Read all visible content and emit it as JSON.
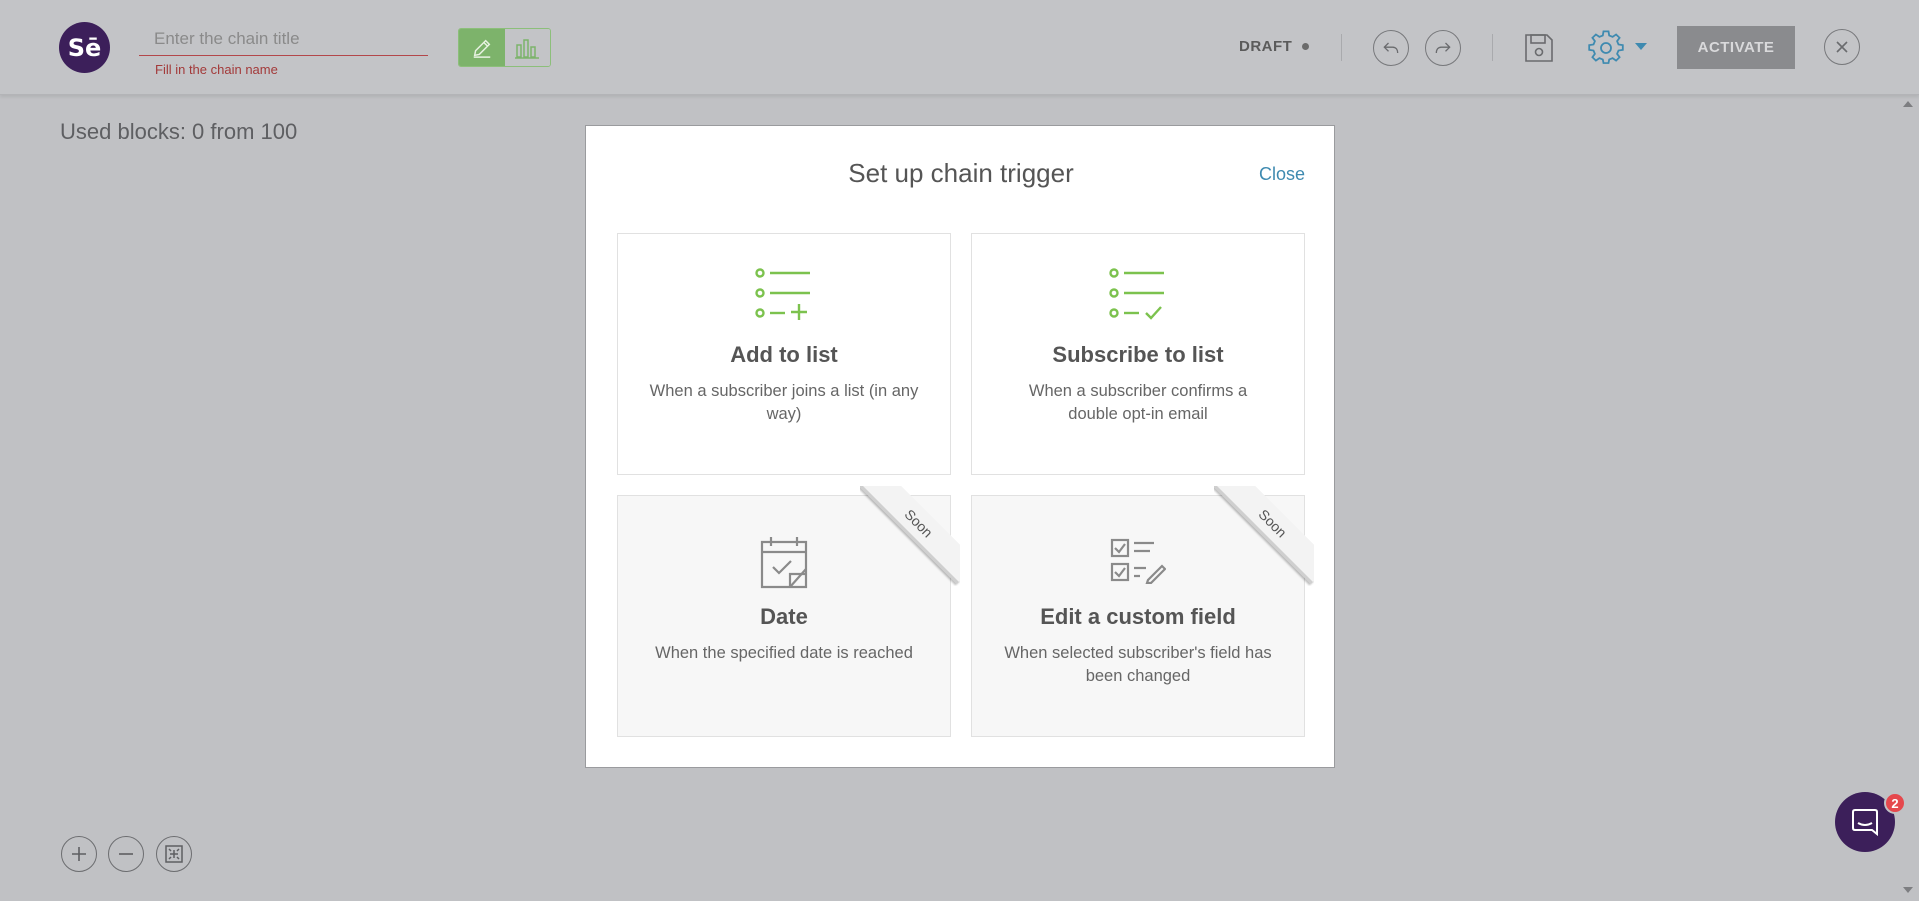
{
  "header": {
    "logo_text": "Sē",
    "title_placeholder": "Enter the chain title",
    "title_value": "",
    "title_error": "Fill in the chain name",
    "status": "DRAFT",
    "activate_label": "ACTIVATE",
    "icons": [
      "pencil-icon",
      "bar-chart-icon",
      "undo-icon",
      "redo-icon",
      "save-icon",
      "gear-icon",
      "close-icon"
    ]
  },
  "canvas": {
    "used_blocks": "Used blocks: 0 from 100"
  },
  "modal": {
    "title": "Set up chain trigger",
    "close_label": "Close",
    "cards": [
      {
        "title": "Add to list",
        "description": "When a subscriber joins a list (in any way)",
        "icon": "list-add-icon",
        "ribbon": ""
      },
      {
        "title": "Subscribe to list",
        "description": "When a subscriber confirms a double opt-in email",
        "icon": "list-check-icon",
        "ribbon": ""
      },
      {
        "title": "Date",
        "description": "When the specified date is reached",
        "icon": "calendar-icon",
        "ribbon": "Soon"
      },
      {
        "title": "Edit a custom field",
        "description": "When selected subscriber's field has been changed",
        "icon": "checklist-edit-icon",
        "ribbon": "Soon"
      }
    ]
  },
  "chat": {
    "badge_count": "2"
  },
  "colors": {
    "accent_green": "#7cc24e",
    "brand_purple": "#3c1f5a",
    "link_blue": "#3e8ab0",
    "error_red": "#a33a3a",
    "badge_red": "#e5484d"
  }
}
